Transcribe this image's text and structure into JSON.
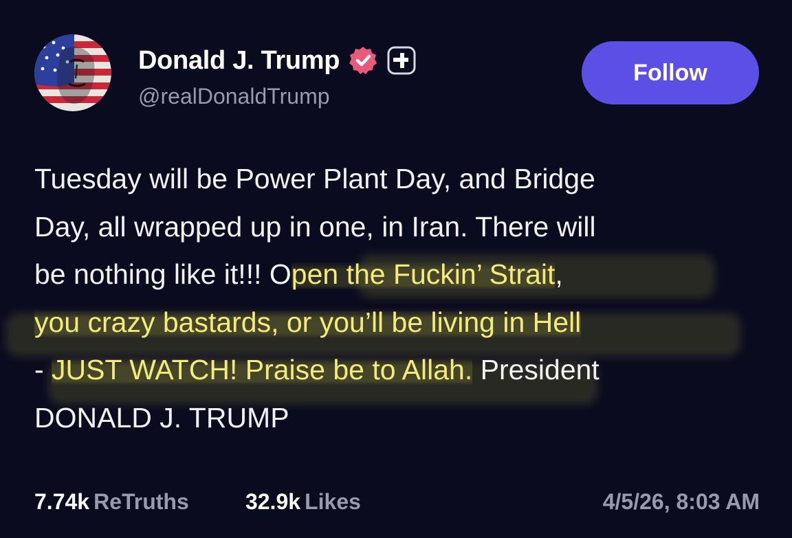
{
  "author": {
    "display_name": "Donald J. Trump",
    "handle": "@realDonaldTrump",
    "verified_icon": "verified-check-badge",
    "subscribe_icon": "plus-square-icon",
    "avatar_icon": "flag-painted-portrait"
  },
  "follow_button": {
    "label": "Follow",
    "color": "#5b4fe6"
  },
  "post": {
    "lines": [
      {
        "normal": "Tuesday will be Power Plant Day, and Bridge",
        "highlight": "",
        "after": ""
      },
      {
        "normal": "Day, all wrapped up in one, in Iran. There will",
        "highlight": "",
        "after": ""
      },
      {
        "normal": "be nothing like it!!! O",
        "highlight": "pen the Fuckin’ Strait",
        "after": ","
      },
      {
        "normal": "",
        "highlight": "you crazy bastards, or you’ll be living in Hell",
        "after": ""
      },
      {
        "normal": "- ",
        "highlight": "JUST WATCH! Praise be to Allah.",
        "after": " President"
      },
      {
        "normal": "DONALD J. TRUMP",
        "highlight": "",
        "after": ""
      }
    ],
    "highlight_color": "#f3ec7c"
  },
  "stats": {
    "retruths_count": "7.74k",
    "retruths_label": "ReTruths",
    "likes_count": "32.9k",
    "likes_label": "Likes",
    "timestamp": "4/5/26, 8:03 AM"
  },
  "colors": {
    "background": "#0b0b1f",
    "text": "#f2f2f5",
    "muted": "#9a9aae",
    "verified": "#e85a7a"
  }
}
